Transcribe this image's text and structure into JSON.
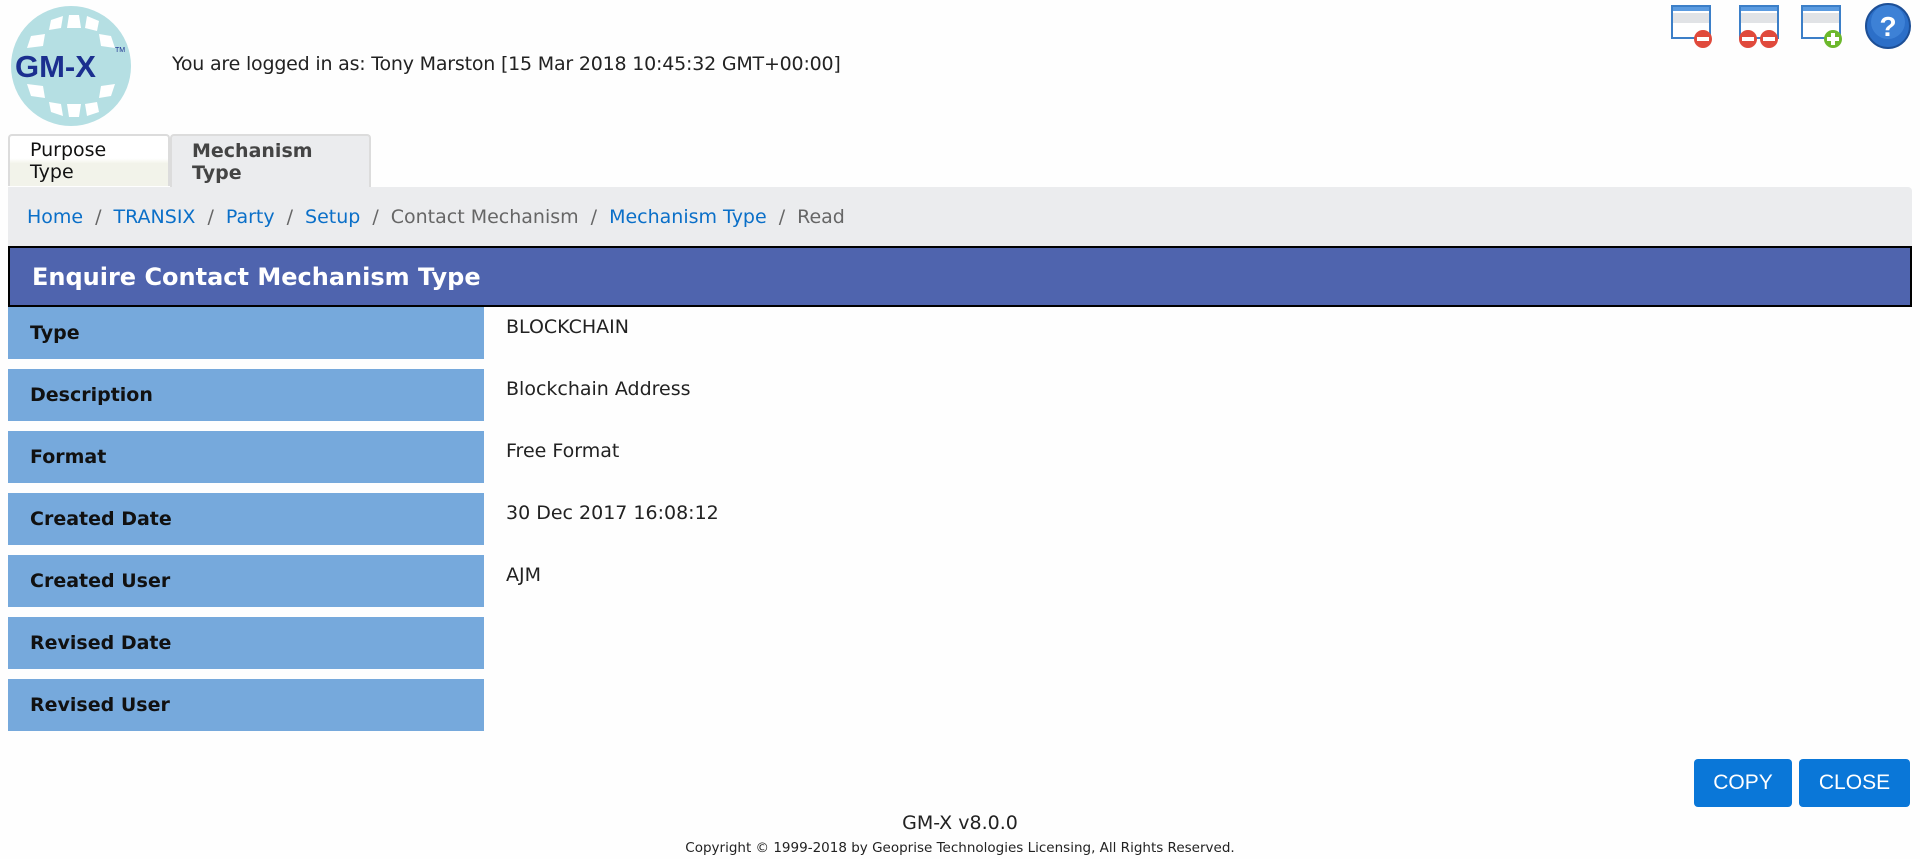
{
  "app": {
    "logo_text": "GM-X",
    "logo_tm": "TM"
  },
  "header": {
    "logged_in_text": "You are logged in as: Tony Marston [15 Mar 2018 10:45:32 GMT+00:00]"
  },
  "toolbar": {
    "icons": [
      {
        "name": "hide-window-icon"
      },
      {
        "name": "hide-all-windows-icon"
      },
      {
        "name": "new-window-icon"
      },
      {
        "name": "help-icon"
      }
    ]
  },
  "tabs": [
    {
      "label": "Purpose Type",
      "active": false
    },
    {
      "label": "Mechanism Type",
      "active": true
    }
  ],
  "breadcrumb": [
    {
      "label": "Home",
      "link": true
    },
    {
      "label": "TRANSIX",
      "link": true
    },
    {
      "label": "Party",
      "link": true
    },
    {
      "label": "Setup",
      "link": true
    },
    {
      "label": "Contact Mechanism",
      "link": false
    },
    {
      "label": "Mechanism Type",
      "link": true
    },
    {
      "label": "Read",
      "link": false
    }
  ],
  "breadcrumb_separator": "/",
  "page_title": "Enquire Contact Mechanism Type",
  "fields": [
    {
      "label": "Type",
      "value": "BLOCKCHAIN"
    },
    {
      "label": "Description",
      "value": "Blockchain Address"
    },
    {
      "label": "Format",
      "value": "Free Format"
    },
    {
      "label": "Created Date",
      "value": "30 Dec 2017 16:08:12"
    },
    {
      "label": "Created User",
      "value": "AJM"
    },
    {
      "label": "Revised Date",
      "value": ""
    },
    {
      "label": "Revised User",
      "value": ""
    }
  ],
  "buttons": {
    "copy": "COPY",
    "close": "CLOSE"
  },
  "footer": {
    "version": "GM-X v8.0.0",
    "copyright": "Copyright © 1999-2018 by Geoprise Technologies Licensing, All Rights Reserved."
  },
  "colors": {
    "header_bg": "#4f64ae",
    "label_bg": "#76a9dc",
    "link": "#0a6fc8",
    "button": "#0a77d8",
    "breadcrumb_bg": "#ebecee"
  }
}
